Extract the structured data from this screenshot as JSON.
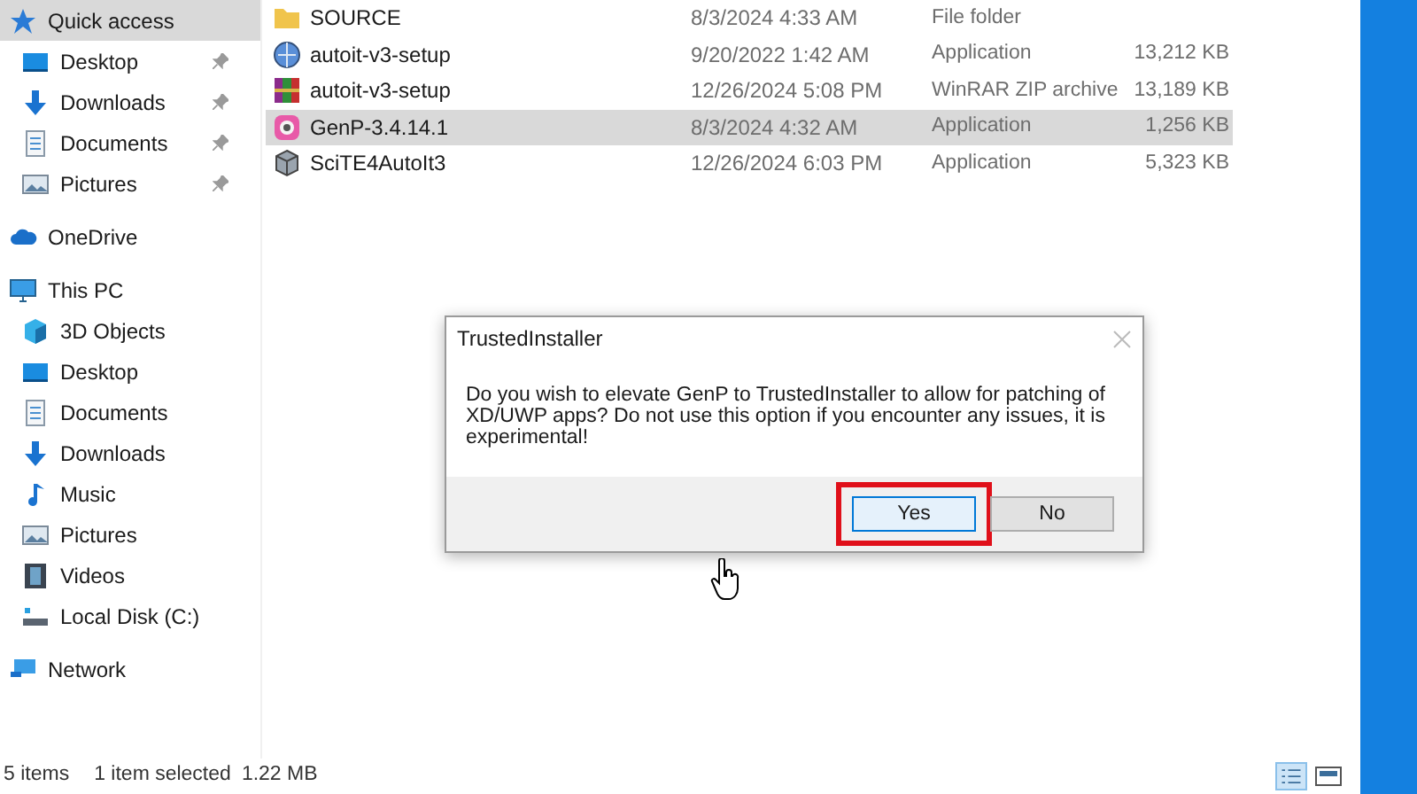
{
  "sidebar": {
    "items": [
      {
        "label": "Quick access",
        "kind": "star",
        "group": true,
        "selected": true,
        "pinned": false
      },
      {
        "label": "Desktop",
        "kind": "desktop",
        "group": false,
        "selected": false,
        "pinned": true
      },
      {
        "label": "Downloads",
        "kind": "download",
        "group": false,
        "selected": false,
        "pinned": true
      },
      {
        "label": "Documents",
        "kind": "document",
        "group": false,
        "selected": false,
        "pinned": true
      },
      {
        "label": "Pictures",
        "kind": "picture",
        "group": false,
        "selected": false,
        "pinned": true
      },
      {
        "label": "OneDrive",
        "kind": "cloud",
        "group": true,
        "selected": false,
        "pinned": false
      },
      {
        "label": "This PC",
        "kind": "monitor",
        "group": true,
        "selected": false,
        "pinned": false
      },
      {
        "label": "3D Objects",
        "kind": "cube",
        "group": false,
        "selected": false,
        "pinned": false
      },
      {
        "label": "Desktop",
        "kind": "desktop",
        "group": false,
        "selected": false,
        "pinned": false
      },
      {
        "label": "Documents",
        "kind": "document",
        "group": false,
        "selected": false,
        "pinned": false
      },
      {
        "label": "Downloads",
        "kind": "download",
        "group": false,
        "selected": false,
        "pinned": false
      },
      {
        "label": "Music",
        "kind": "music",
        "group": false,
        "selected": false,
        "pinned": false
      },
      {
        "label": "Pictures",
        "kind": "picture",
        "group": false,
        "selected": false,
        "pinned": false
      },
      {
        "label": "Videos",
        "kind": "film",
        "group": false,
        "selected": false,
        "pinned": false
      },
      {
        "label": "Local Disk (C:)",
        "kind": "disk",
        "group": false,
        "selected": false,
        "pinned": false
      },
      {
        "label": "Network",
        "kind": "network",
        "group": true,
        "selected": false,
        "pinned": false
      }
    ]
  },
  "files": [
    {
      "name": "SOURCE",
      "kind": "folder",
      "date": "8/3/2024 4:33 AM",
      "type": "File folder",
      "selected": false
    },
    {
      "name": "autoit-v3-setup",
      "kind": "globe",
      "date": "9/20/2022 1:42 AM",
      "type": "Application",
      "size": "13,212 KB",
      "selected": false
    },
    {
      "name": "autoit-v3-setup",
      "kind": "archive",
      "date": "12/26/2024 5:08 PM",
      "type": "WinRAR ZIP archive",
      "size": "13,189 KB",
      "selected": false
    },
    {
      "name": "GenP-3.4.14.1",
      "kind": "app",
      "date": "8/3/2024 4:32 AM",
      "type": "Application",
      "size": "1,256 KB",
      "selected": true
    },
    {
      "name": "SciTE4AutoIt3",
      "kind": "package",
      "date": "12/26/2024 6:03 PM",
      "type": "Application",
      "size": "5,323 KB",
      "selected": false
    }
  ],
  "status_bar": {
    "count": "5 items",
    "selection": "1 item selected",
    "size": "1.22 MB"
  },
  "dialog": {
    "title": "TrustedInstaller",
    "message": "Do you wish to elevate GenP to TrustedInstaller to allow for patching of XD/UWP apps? Do not use this option if you encounter any issues, it is experimental!",
    "buttons": [
      {
        "label": "Yes",
        "selected": true,
        "highlighted": true
      },
      {
        "label": "No",
        "selected": false,
        "highlighted": false
      }
    ]
  }
}
